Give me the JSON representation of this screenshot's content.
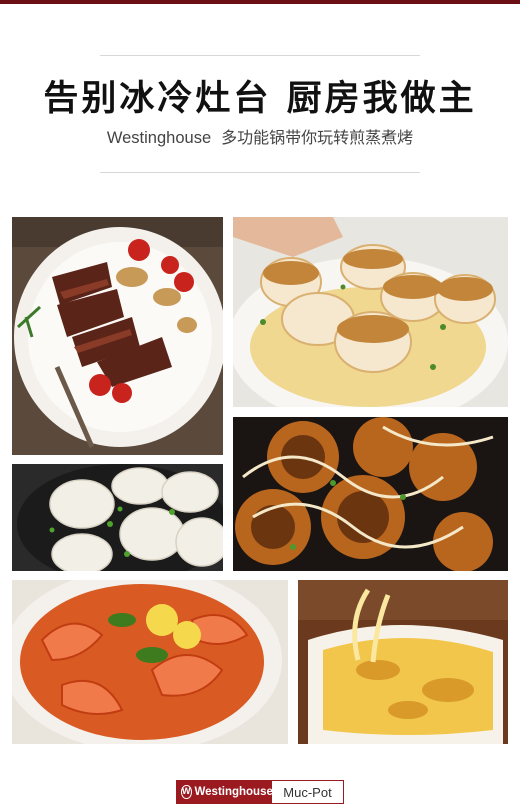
{
  "header": {
    "title": "告别冰冷灶台 厨房我做主",
    "subtitle_brand": "Westinghouse",
    "subtitle_text": "多功能锅带你玩转煎蒸煮烤"
  },
  "photos": [
    {
      "name": "steak-plate-photo"
    },
    {
      "name": "scallops-bowl-photo"
    },
    {
      "name": "dumplings-pot-photo"
    },
    {
      "name": "takoyaki-photo"
    },
    {
      "name": "shrimp-soup-photo"
    },
    {
      "name": "cheese-gratin-photo"
    }
  ],
  "footer_logo": {
    "brand": "Westinghouse",
    "brand_mark": "W",
    "product": "Muc-Pot"
  },
  "colors": {
    "accent": "#9a1a20",
    "top_bar": "#6b0f14"
  }
}
